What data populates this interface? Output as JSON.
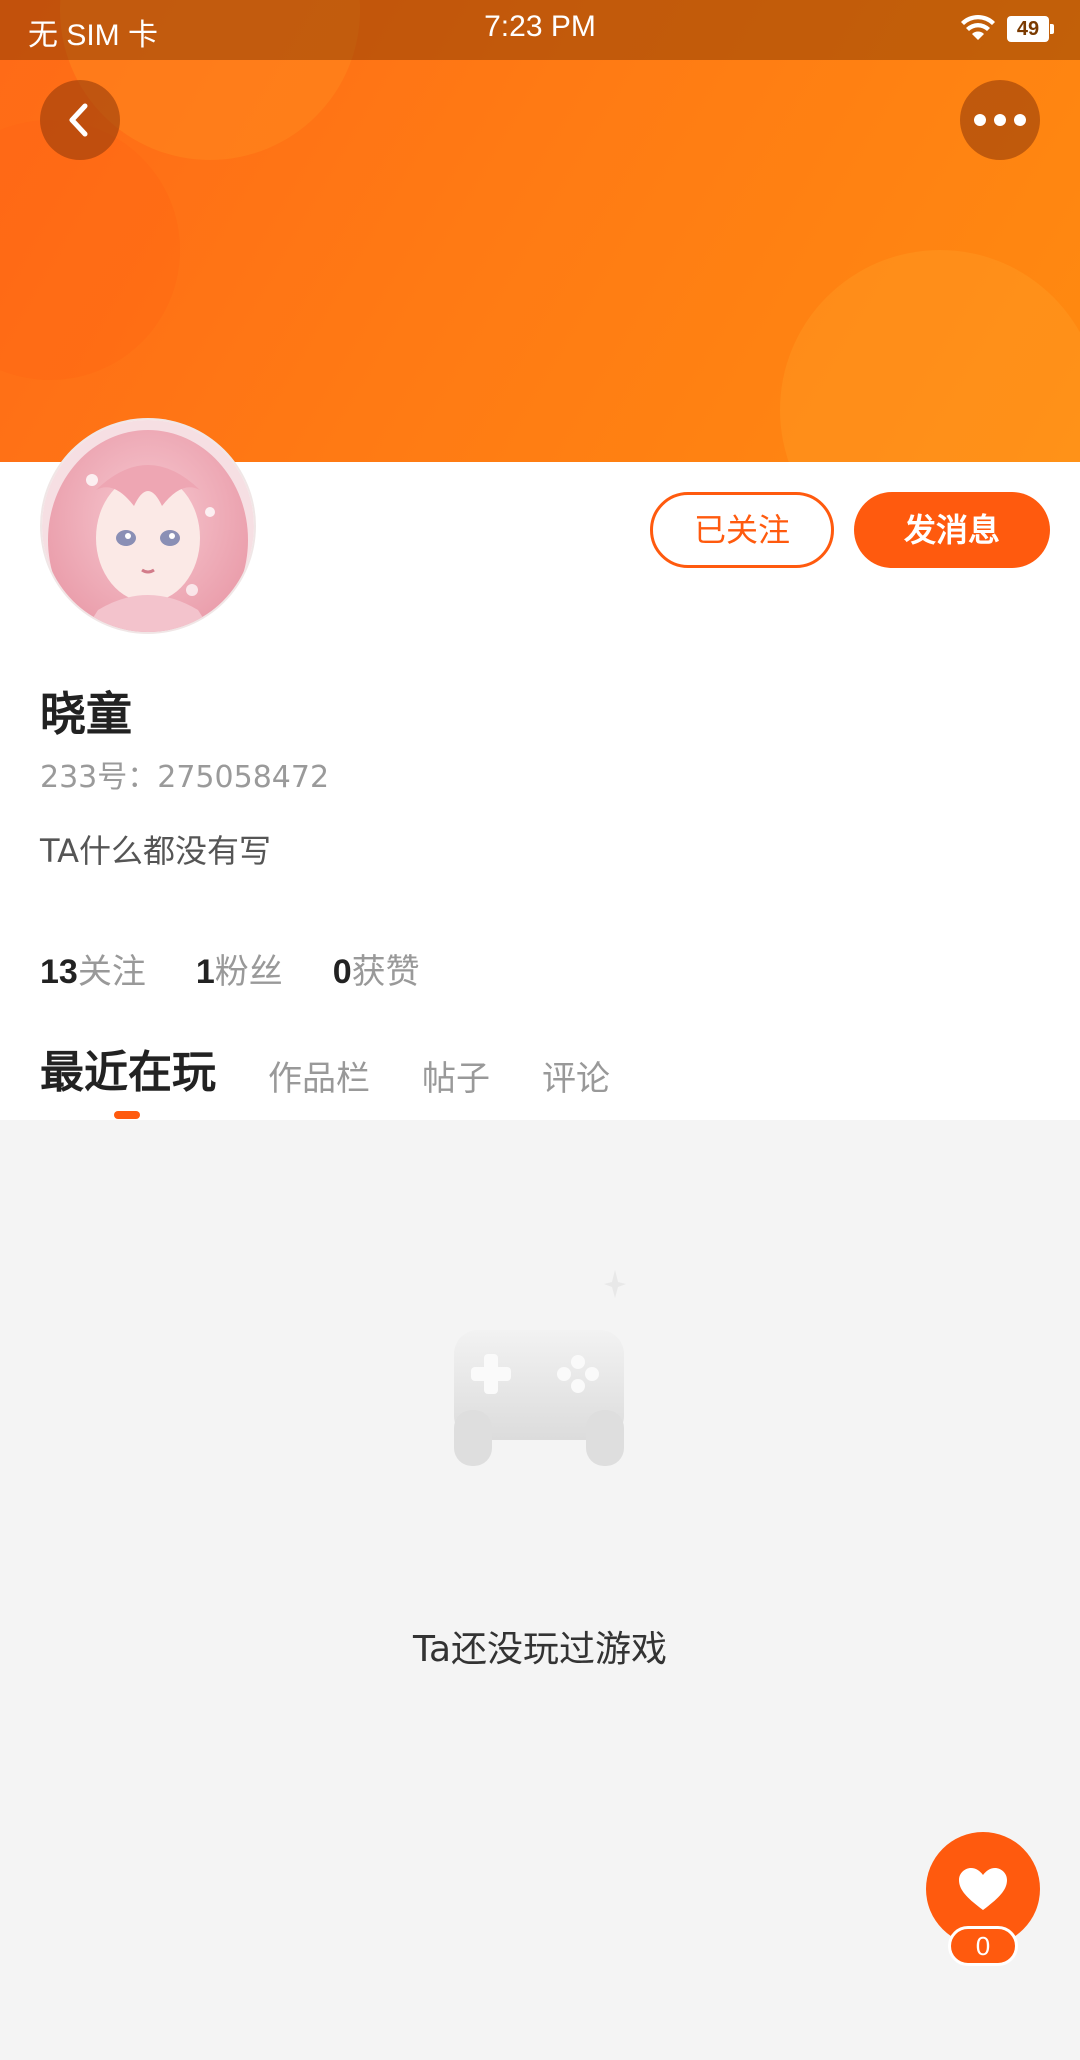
{
  "status_bar": {
    "carrier": "无 SIM 卡",
    "time": "7:23 PM",
    "battery": "49"
  },
  "header": {
    "back_icon": "chevron-left-icon",
    "more_icon": "more-dots-icon",
    "banner_color": "#ff7a14"
  },
  "profile": {
    "avatar_icon": "anime-avatar",
    "follow_label": "已关注",
    "message_label": "发消息",
    "username": "晓童",
    "uid": "233号：275058472",
    "bio": "TA什么都没有写",
    "stats": [
      {
        "num": "13",
        "label": "关注"
      },
      {
        "num": "1",
        "label": "粉丝"
      },
      {
        "num": "0",
        "label": "获赞"
      }
    ]
  },
  "tabs": [
    {
      "label": "最近在玩",
      "active": true
    },
    {
      "label": "作品栏",
      "active": false
    },
    {
      "label": "帖子",
      "active": false
    },
    {
      "label": "评论",
      "active": false
    }
  ],
  "empty_state": {
    "icon": "gamepad-icon",
    "text": "Ta还没玩过游戏"
  },
  "like": {
    "icon": "heart-icon",
    "count": "0"
  },
  "colors": {
    "accent": "#ff5a0e",
    "muted_text": "#999999",
    "page_bg": "#f4f4f4"
  }
}
